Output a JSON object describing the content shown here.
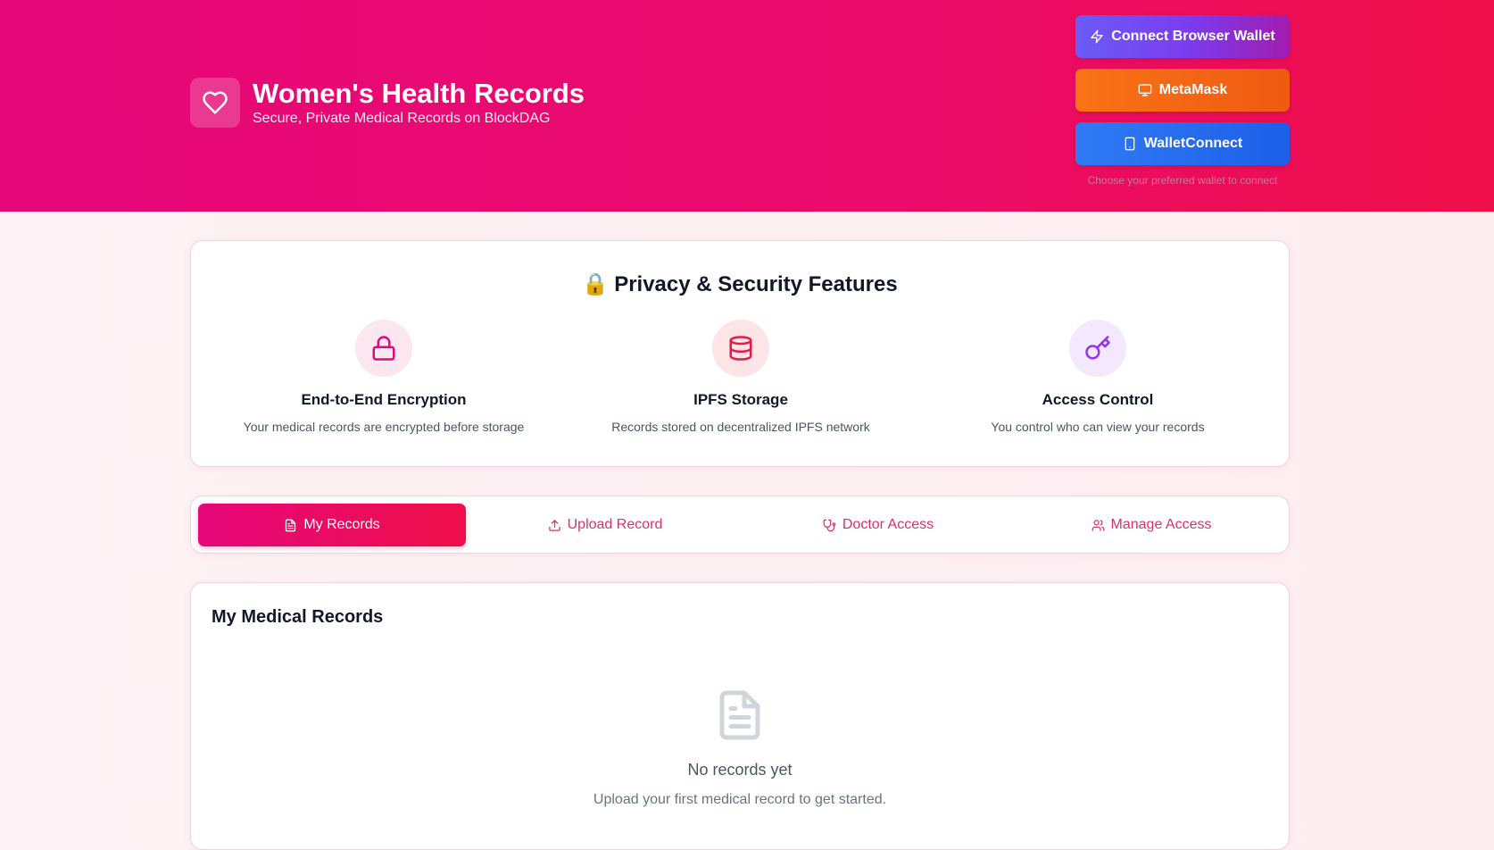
{
  "header": {
    "title": "Women's Health Records",
    "subtitle": "Secure, Private Medical Records on BlockDAG"
  },
  "wallets": {
    "browser_label": "Connect Browser Wallet",
    "metamask_label": "MetaMask",
    "walletconnect_label": "WalletConnect",
    "hint": "Choose your preferred wallet to connect"
  },
  "features": {
    "title_emoji": "🔒",
    "title": "Privacy & Security Features",
    "items": [
      {
        "name": "End-to-End Encryption",
        "desc": "Your medical records are encrypted before storage",
        "icon": "lock-icon",
        "color": "#e6077a",
        "bg": "#fce7f0"
      },
      {
        "name": "IPFS Storage",
        "desc": "Records stored on decentralized IPFS network",
        "icon": "database-icon",
        "color": "#e11d48",
        "bg": "#fde4e6"
      },
      {
        "name": "Access Control",
        "desc": "You control who can view your records",
        "icon": "key-icon",
        "color": "#9333ea",
        "bg": "#f3e8fd"
      }
    ]
  },
  "tabs": [
    {
      "label": "My Records",
      "icon": "file-text-icon",
      "active": true
    },
    {
      "label": "Upload Record",
      "icon": "upload-icon",
      "active": false
    },
    {
      "label": "Doctor Access",
      "icon": "stethoscope-icon",
      "active": false
    },
    {
      "label": "Manage Access",
      "icon": "users-icon",
      "active": false
    }
  ],
  "records": {
    "title": "My Medical Records",
    "empty_title": "No records yet",
    "empty_sub": "Upload your first medical record to get started."
  }
}
